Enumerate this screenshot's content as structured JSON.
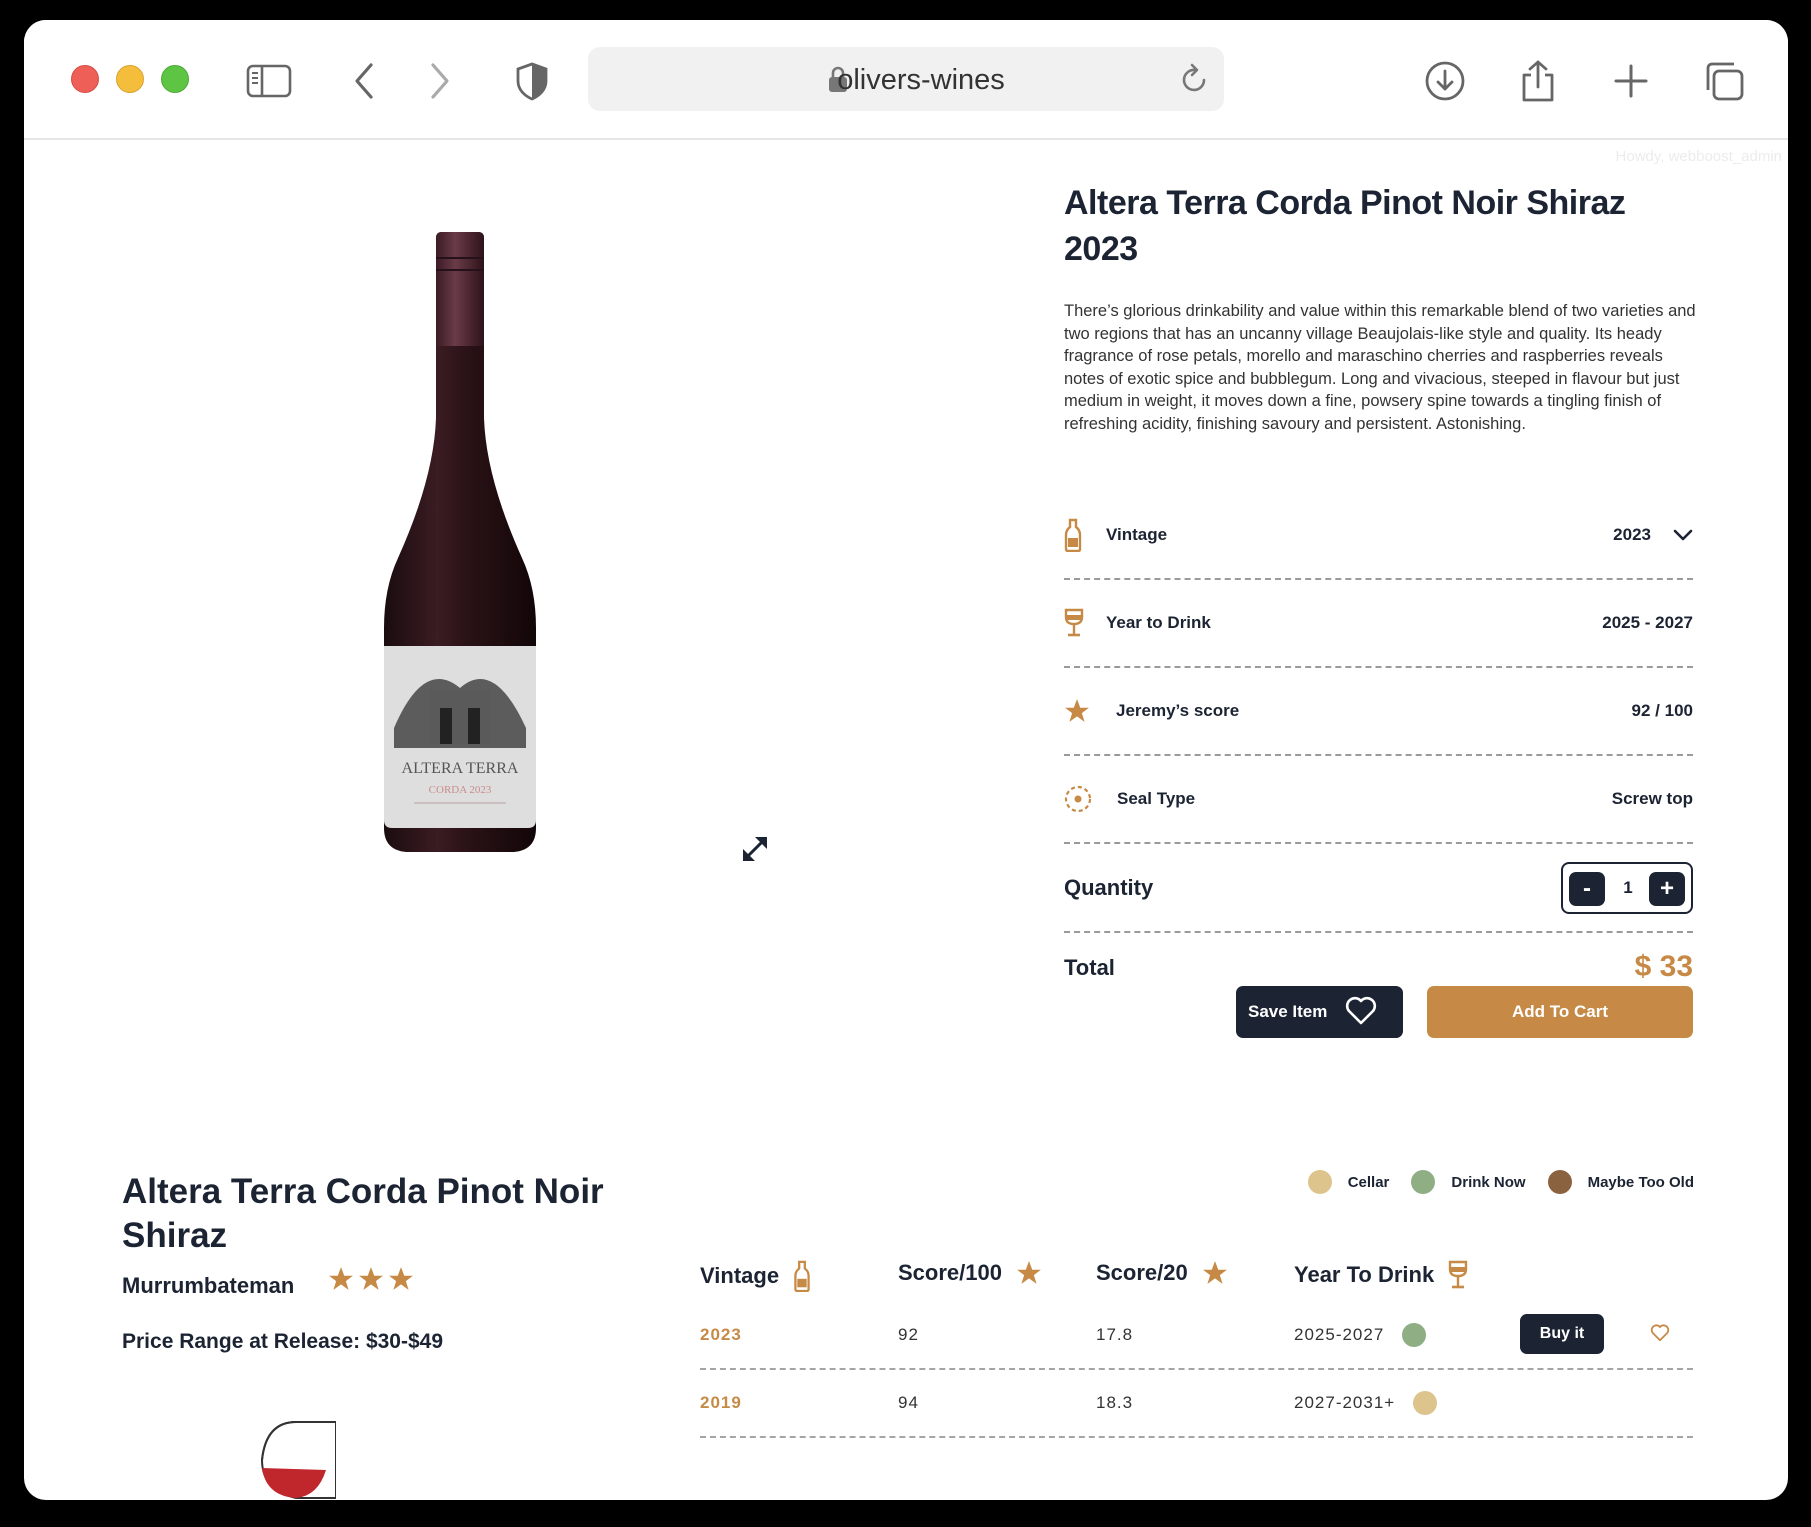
{
  "browser": {
    "url": "olivers-wines",
    "icons": [
      "sidebar-icon",
      "back-icon",
      "forward-icon",
      "shield-icon",
      "lock-icon",
      "reload-icon",
      "download-icon",
      "share-icon",
      "new-tab-icon",
      "tabs-icon"
    ]
  },
  "admin_bar": {
    "text": "Howdy, webboost_admin"
  },
  "product": {
    "title": "Altera Terra Corda Pinot Noir Shiraz 2023",
    "description": "There’s glorious drinkability and value within this remarkable blend of two varieties and two regions that has an uncanny village Beaujolais-like style and quality. Its heady fragrance of rose petals, morello and maraschino cherries and raspberries reveals notes of exotic spice and bubblegum. Long and vivacious, steeped in flavour but just medium in weight, it moves down a fine, powsery spine towards a tingling finish of refreshing acidity, finishing savoury and persistent. Astonishing.",
    "attributes": [
      {
        "label": "Vintage",
        "value": "2023",
        "icon": "bottle-icon"
      },
      {
        "label": "Year to Drink",
        "value": "2025 - 2027",
        "icon": "wine-glass-icon"
      },
      {
        "label": "Jeremy’s score",
        "value": "92 / 100",
        "icon": "star-icon"
      },
      {
        "label": "Seal Type",
        "value": "Screw top",
        "icon": "seal-icon"
      }
    ],
    "quantity_label": "Quantity",
    "quantity": "1",
    "minus_label": "-",
    "plus_label": "+",
    "total_label": "Total",
    "total_value": "$ 33",
    "save_label": "Save Item",
    "cart_label": "Add To Cart"
  },
  "vintages_section": {
    "title": "Altera Terra Corda Pinot Noir Shiraz",
    "region": "Murrumbateman",
    "star_rating": 3,
    "price_range": "Price Range at Release: $30-$49",
    "legend": [
      {
        "label": "Cellar",
        "color": "#dcc48c"
      },
      {
        "label": "Drink Now",
        "color": "#8fae84"
      },
      {
        "label": "Maybe Too Old",
        "color": "#8a6240"
      }
    ],
    "headers": [
      "Vintage",
      "Score/100",
      "Score/20",
      "Year To Drink"
    ],
    "rows": [
      {
        "vintage": "2023",
        "score100": "92",
        "score20": "17.8",
        "drink": "2025-2027",
        "status_color": "#8fae84",
        "buy_label": "Buy it"
      },
      {
        "vintage": "2019",
        "score100": "94",
        "score20": "18.3",
        "drink": "2027-2031+",
        "status_color": "#dcc48c"
      }
    ]
  },
  "colors": {
    "navy": "#1c2433",
    "accent": "#c78a46"
  }
}
